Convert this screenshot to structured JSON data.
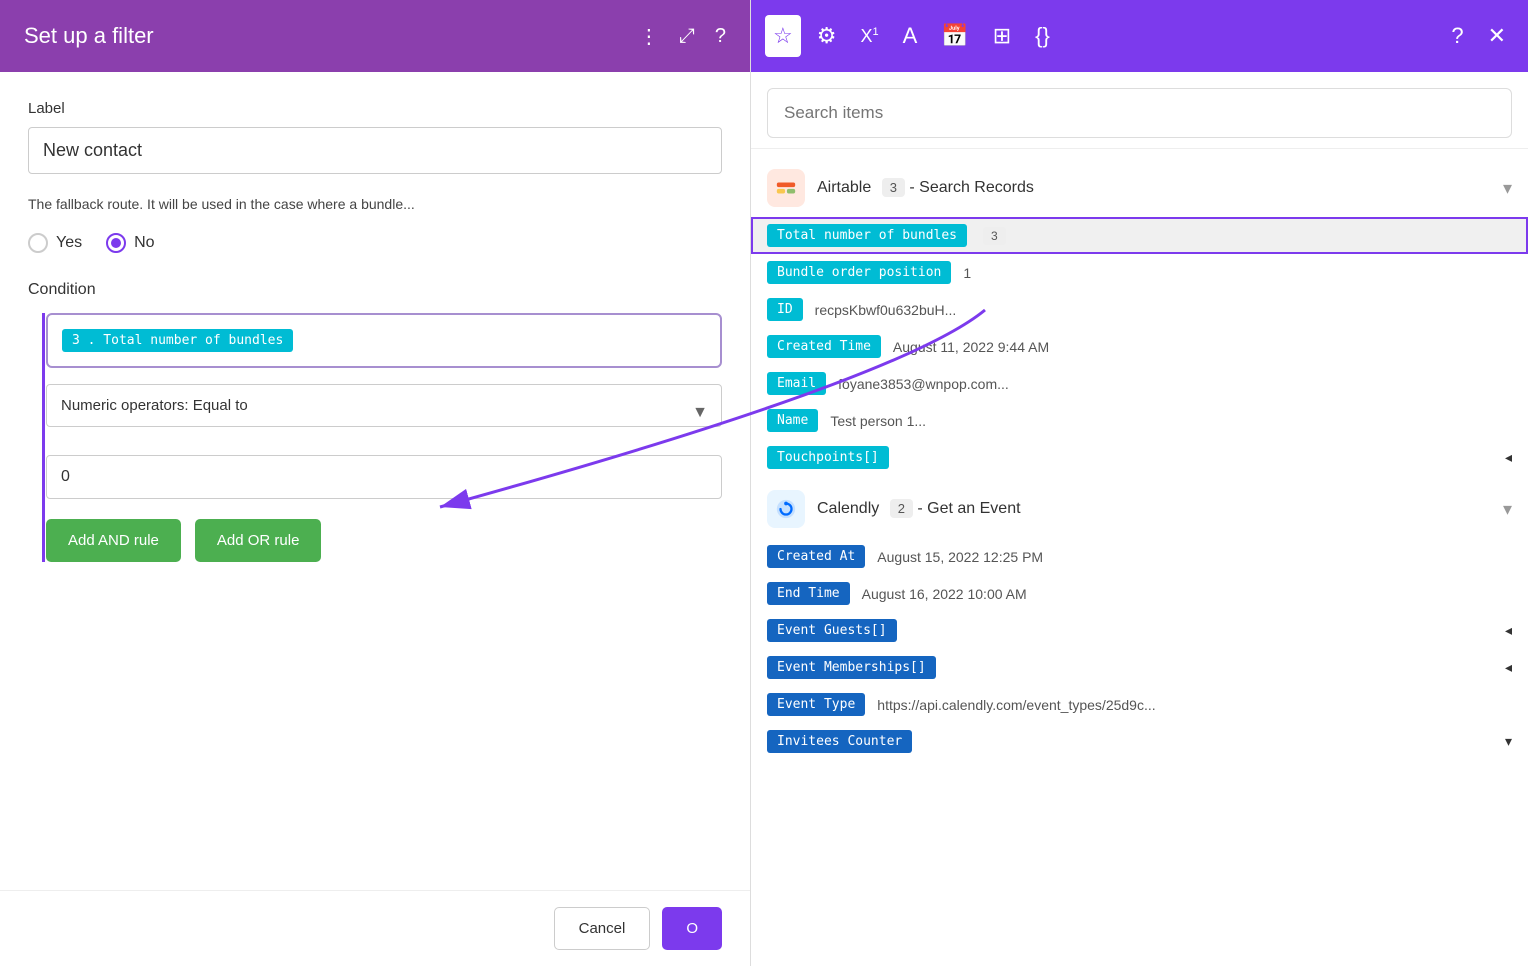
{
  "leftPanel": {
    "header": {
      "title": "Set up a filter",
      "icons": [
        "more-icon",
        "expand-icon",
        "help-icon"
      ]
    },
    "labelField": {
      "label": "Label",
      "value": "New contact"
    },
    "description": "The fallback route. It will be used in the case where a bundle...",
    "radioGroup": {
      "options": [
        "Yes",
        "No"
      ],
      "selected": "No"
    },
    "conditionLabel": "Condition",
    "conditionTag": "3 . Total number of bundles",
    "operatorLabel": "Numeric operators: Equal to",
    "valueInput": "0",
    "buttons": {
      "addAnd": "Add AND rule",
      "addOr": "Add OR rule"
    },
    "bottomActions": {
      "cancel": "Cancel"
    }
  },
  "rightPanel": {
    "headerIcons": [
      "star-icon",
      "gear-icon",
      "superscript-icon",
      "text-icon",
      "calendar-icon",
      "table-icon",
      "code-icon",
      "help-icon",
      "close-icon"
    ],
    "search": {
      "placeholder": "Search items"
    },
    "sources": [
      {
        "id": "airtable",
        "name": "Airtable",
        "badge": "3",
        "subtitle": "- Search Records",
        "items": [
          {
            "tag": "Total number of bundles",
            "tagColor": "cyan",
            "badge": "3",
            "value": "",
            "highlighted": true
          },
          {
            "tag": "Bundle order position",
            "tagColor": "cyan",
            "badge": "1",
            "value": "",
            "highlighted": false
          },
          {
            "tag": "ID",
            "tagColor": "cyan",
            "badge": "",
            "value": "recpsKbwf0u632buH...",
            "highlighted": false
          },
          {
            "tag": "Created Time",
            "tagColor": "cyan",
            "badge": "",
            "value": "August 11, 2022 9:44 AM",
            "highlighted": false
          },
          {
            "tag": "Email",
            "tagColor": "cyan",
            "badge": "",
            "value": "foyane3853@wnpop.com...",
            "highlighted": false
          },
          {
            "tag": "Name",
            "tagColor": "cyan",
            "badge": "",
            "value": "Test person 1...",
            "highlighted": false
          },
          {
            "tag": "Touchpoints[]",
            "tagColor": "cyan",
            "badge": "",
            "value": "",
            "hasArrow": true,
            "highlighted": false
          }
        ]
      },
      {
        "id": "calendly",
        "name": "Calendly",
        "badge": "2",
        "subtitle": "- Get an Event",
        "items": [
          {
            "tag": "Created At",
            "tagColor": "blue",
            "badge": "",
            "value": "August 15, 2022 12:25 PM",
            "highlighted": false
          },
          {
            "tag": "End Time",
            "tagColor": "blue",
            "badge": "",
            "value": "August 16, 2022 10:00 AM",
            "highlighted": false
          },
          {
            "tag": "Event Guests[]",
            "tagColor": "blue",
            "badge": "",
            "value": "",
            "hasArrow": true,
            "highlighted": false
          },
          {
            "tag": "Event Memberships[]",
            "tagColor": "blue",
            "badge": "",
            "value": "",
            "hasArrow": true,
            "highlighted": false
          },
          {
            "tag": "Event Type",
            "tagColor": "blue",
            "badge": "",
            "value": "https://api.calendly.com/event_types/25d9c...",
            "highlighted": false
          },
          {
            "tag": "Invitees Counter",
            "tagColor": "blue",
            "badge": "",
            "value": "",
            "hasDropdown": true,
            "highlighted": false
          }
        ]
      }
    ]
  }
}
